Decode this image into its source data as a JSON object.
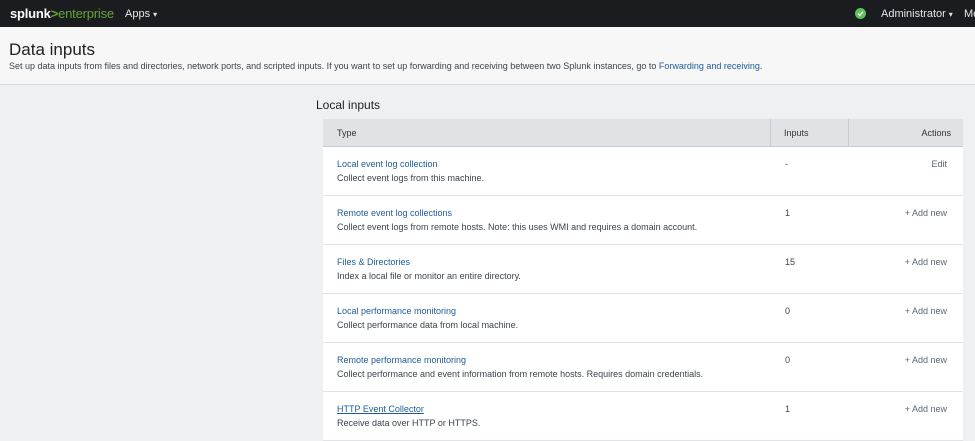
{
  "topbar": {
    "logo_splunk": "splunk",
    "logo_gt": ">",
    "logo_enterprise": "enterprise",
    "apps_label": "Apps",
    "user_label": "Administrator",
    "more_label": "Me",
    "caret": "▾",
    "status_icon": "check-circle-icon"
  },
  "header": {
    "title": "Data inputs",
    "description": "Set up data inputs from files and directories, network ports, and scripted inputs. If you want to set up forwarding and receiving between two Splunk instances, go to ",
    "link": "Forwarding and receiving",
    "period": "."
  },
  "section": {
    "title": "Local inputs"
  },
  "table": {
    "columns": {
      "type": "Type",
      "inputs": "Inputs",
      "actions": "Actions"
    },
    "rows": [
      {
        "name": "Local event log collection",
        "description": "Collect event logs from this machine.",
        "inputs": "-",
        "action": "Edit"
      },
      {
        "name": "Remote event log collections",
        "description": "Collect event logs from remote hosts. Note: this uses WMI and requires a domain account.",
        "inputs": "1",
        "action": "+ Add new"
      },
      {
        "name": "Files & Directories",
        "description": "Index a local file or monitor an entire directory.",
        "inputs": "15",
        "action": "+ Add new"
      },
      {
        "name": "Local performance monitoring",
        "description": "Collect performance data from local machine.",
        "inputs": "0",
        "action": "+ Add new"
      },
      {
        "name": "Remote performance monitoring",
        "description": "Collect performance and event information from remote hosts. Requires domain credentials.",
        "inputs": "0",
        "action": "+ Add new"
      },
      {
        "name": "HTTP Event Collector",
        "description": "Receive data over HTTP or HTTPS.",
        "inputs": "1",
        "action": "+ Add new"
      }
    ]
  },
  "colors": {
    "topbar_bg": "#1a1c20",
    "brand_green": "#65a637",
    "link_blue": "#1e5b9a",
    "status_green": "#5cc05c"
  }
}
